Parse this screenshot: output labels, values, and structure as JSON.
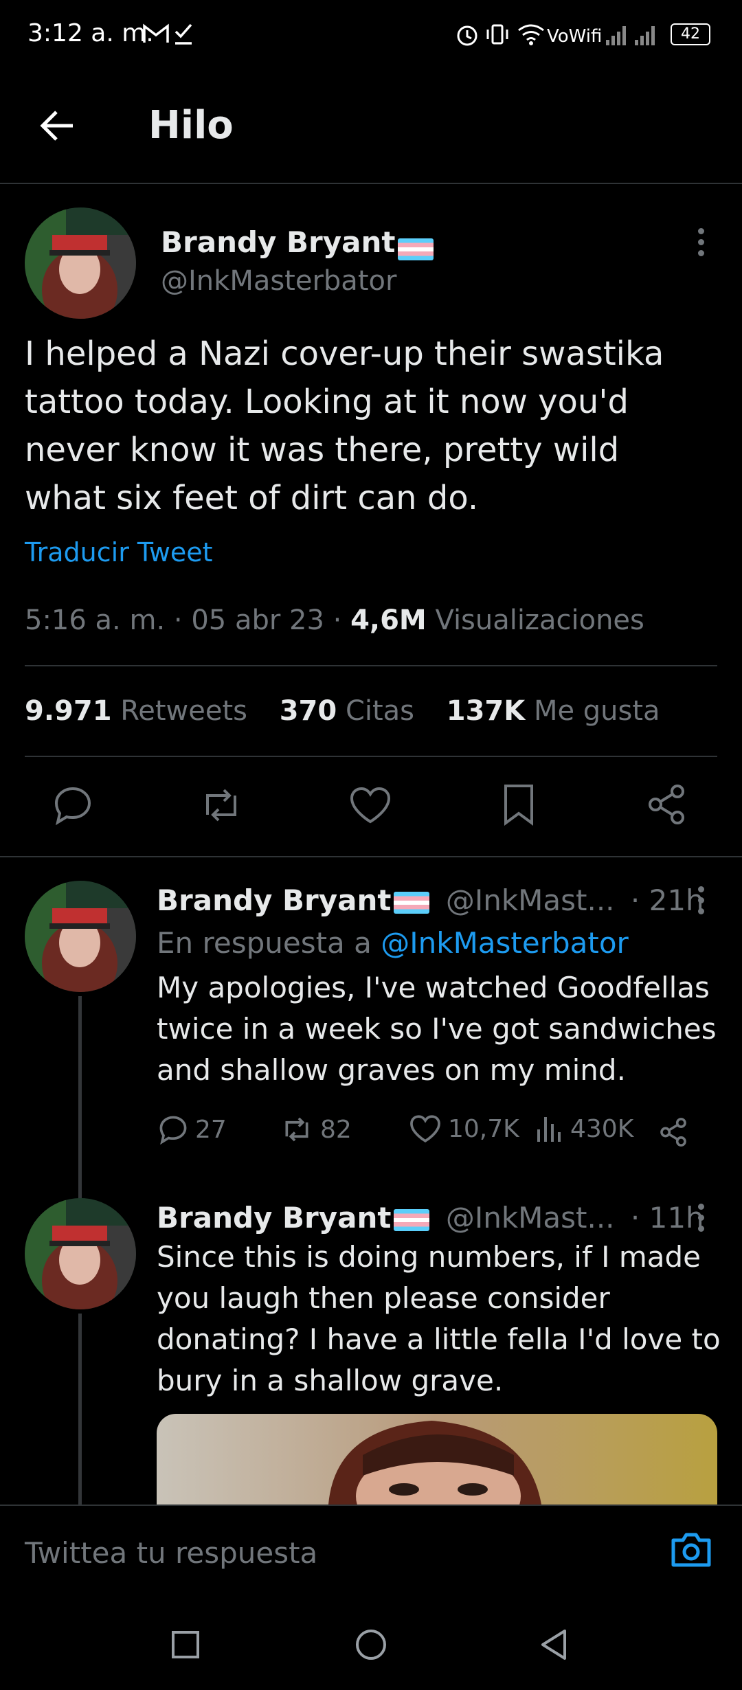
{
  "status_bar": {
    "time": "3:12 a. m.",
    "network": "VoWifi",
    "battery": "42"
  },
  "header": {
    "title": "Hilo"
  },
  "main_tweet": {
    "name": "Brandy Bryant",
    "handle": "@InkMasterbator",
    "text_lines": [
      "I helped a Nazi cover-up their swastika",
      "tattoo today. Looking at it now you'd",
      "never know it was there, pretty wild",
      "what six feet of dirt can do."
    ],
    "translate": "Traducir Tweet",
    "time": "5:16 a. m.",
    "date": "05 abr 23",
    "views_count": "4,6M",
    "views_label": "Visualizaciones",
    "retweets_count": "9.971",
    "retweets_label": "Retweets",
    "quotes_count": "370",
    "quotes_label": "Citas",
    "likes_count": "137K",
    "likes_label": "Me gusta"
  },
  "replies": [
    {
      "name": "Brandy Bryant",
      "handle": "@InkMast...",
      "time": "· 21h",
      "reply_prefix": "En respuesta a",
      "reply_to": "@InkMasterbator",
      "text_lines": [
        "My apologies, I've watched Goodfellas",
        "twice in a week so I've got sandwiches",
        "and shallow graves on my mind."
      ],
      "replies": "27",
      "retweets": "82",
      "likes": "10,7K",
      "views": "430K"
    },
    {
      "name": "Brandy Bryant",
      "handle": "@InkMast...",
      "time": "· 11h",
      "text_lines": [
        "Since this is doing numbers, if I made",
        "you laugh then please consider",
        "donating? I have a little fella I'd love to",
        "bury in a shallow grave."
      ]
    }
  ],
  "compose": {
    "placeholder": "Twittea tu respuesta"
  },
  "icons": [
    "back-arrow-icon",
    "more-icon",
    "comment-icon",
    "retweet-icon",
    "heart-icon",
    "bookmark-icon",
    "share-icon",
    "views-icon",
    "camera-icon",
    "recents-icon",
    "home-icon",
    "back-icon"
  ],
  "colors": {
    "background": "#000000",
    "accent": "#1d9bf0",
    "text": "#e7e9ea",
    "muted": "#71767b",
    "divider": "#2f3336"
  }
}
